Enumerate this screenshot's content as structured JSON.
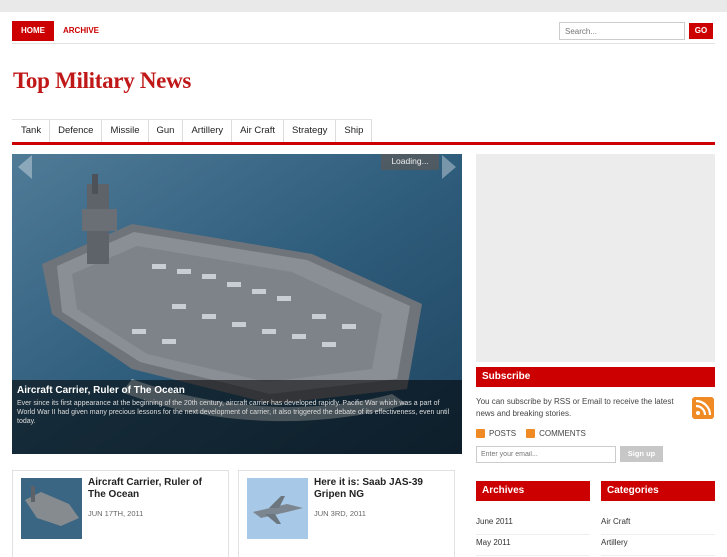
{
  "topnav": {
    "items": [
      {
        "label": "HOME",
        "active": true
      },
      {
        "label": "ARCHIVE",
        "active": false
      }
    ],
    "search_placeholder": "Search...",
    "go_label": "GO"
  },
  "site": {
    "title": "Top Military News"
  },
  "categories": [
    "Tank",
    "Defence",
    "Missile",
    "Gun",
    "Artillery",
    "Air Craft",
    "Strategy",
    "Ship"
  ],
  "slider": {
    "loading": "Loading...",
    "title": "Aircraft Carrier, Ruler of The Ocean",
    "excerpt": "Ever since its first appearance at the beginning of the 20th century, aircraft carrier has developed rapidly. Pacific War which was a part of World War II had given many precious lessons for the next development of carrier, it also triggered the debate of its effectiveness, even until today."
  },
  "posts": [
    {
      "title": "Aircraft Carrier, Ruler of The Ocean",
      "date": "JUN 17TH, 2011"
    },
    {
      "title": "Here it is: Saab JAS-39 Gripen NG",
      "date": "JUN 3RD, 2011"
    }
  ],
  "subscribe": {
    "heading": "Subscribe",
    "text": "You can subscribe by RSS or Email to receive the latest news and breaking stories.",
    "posts_label": "POSTS",
    "comments_label": "COMMENTS",
    "email_placeholder": "Enter your email...",
    "signup_label": "Sign up"
  },
  "archives": {
    "heading": "Archives",
    "items": [
      "June 2011",
      "May 2011"
    ]
  },
  "categories_widget": {
    "heading": "Categories",
    "items": [
      "Air Craft",
      "Artillery"
    ]
  },
  "colors": {
    "accent": "#cc0000",
    "brand_title": "#c01818"
  }
}
